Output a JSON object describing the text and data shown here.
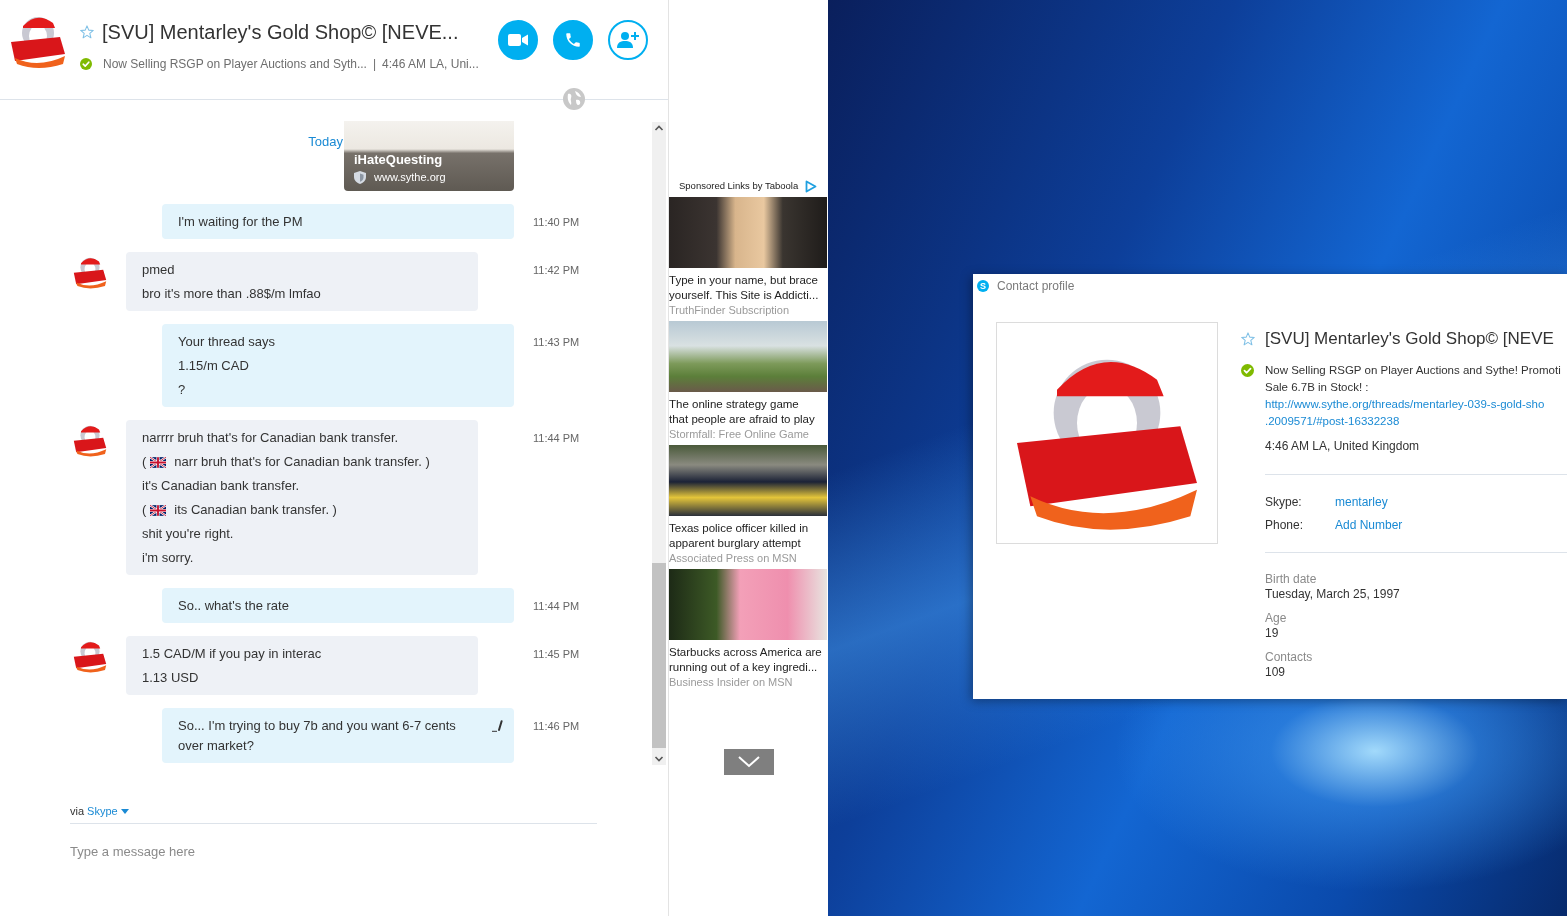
{
  "conversation_header": {
    "title": "[SVU] Mentarley's Gold Shop© [NEVE...",
    "favorite": false,
    "online": true,
    "mood": "Now Selling RSGP on Player Auctions and Syth...",
    "separator": "|",
    "local_time": "4:46 AM LA, Uni..."
  },
  "chat": {
    "date_label": "Today",
    "link_preview": {
      "title": "iHateQuesting",
      "site": "www.sythe.org"
    },
    "messages": [
      {
        "kind": "outgoing",
        "time": "11:40 PM",
        "edited": false,
        "lines": [
          {
            "kind": "text",
            "text": "I'm waiting for the PM"
          }
        ]
      },
      {
        "kind": "incoming",
        "time": "11:42 PM",
        "edited": false,
        "lines": [
          {
            "kind": "text",
            "text": "pmed"
          },
          {
            "kind": "text",
            "text": "bro it's more than .88$/m lmfao"
          }
        ]
      },
      {
        "kind": "outgoing",
        "time": "11:43 PM",
        "edited": false,
        "lines": [
          {
            "kind": "text",
            "text": "Your thread says"
          },
          {
            "kind": "text",
            "text": "1.15/m CAD"
          },
          {
            "kind": "text",
            "text": "?"
          }
        ]
      },
      {
        "kind": "incoming",
        "time": "11:44 PM",
        "edited": false,
        "lines": [
          {
            "kind": "text",
            "text": "narrrr bruh that's for Canadian bank transfer."
          },
          {
            "kind": "translation",
            "open": "(",
            "text": "narr bruh that's for Canadian bank transfer. )"
          },
          {
            "kind": "text",
            "text": "it's Canadian bank transfer."
          },
          {
            "kind": "translation",
            "open": "(",
            "text": "its Canadian bank transfer. )"
          },
          {
            "kind": "text",
            "text": "shit you're right."
          },
          {
            "kind": "text",
            "text": "i'm sorry."
          }
        ]
      },
      {
        "kind": "outgoing",
        "time": "11:44 PM",
        "edited": false,
        "lines": [
          {
            "kind": "text",
            "text": "So.. what's the rate"
          }
        ]
      },
      {
        "kind": "incoming",
        "time": "11:45 PM",
        "edited": false,
        "lines": [
          {
            "kind": "text",
            "text": "1.5 CAD/M if you pay in interac"
          },
          {
            "kind": "text",
            "text": "1.13 USD"
          }
        ]
      },
      {
        "kind": "outgoing",
        "time": "11:46 PM",
        "edited": true,
        "lines": [
          {
            "kind": "text",
            "text": "So... I'm trying to buy 7b and you want 6-7 cents over market?"
          }
        ]
      }
    ],
    "via": {
      "prefix": "via",
      "network": "Skype"
    },
    "composer": {
      "placeholder": "Type a message here"
    }
  },
  "sponsored": {
    "heading": "Sponsored Links by Taboola",
    "ads": [
      {
        "title_lines": [
          "Type in your name, but brace",
          "yourself. This Site is Addicti..."
        ],
        "source": "TruthFinder Subscription"
      },
      {
        "title_lines": [
          "The online strategy game",
          "that people are afraid to play"
        ],
        "source": "Stormfall: Free Online Game"
      },
      {
        "title_lines": [
          "Texas police officer killed in",
          "apparent burglary attempt"
        ],
        "source": "Associated Press on MSN"
      },
      {
        "title_lines": [
          "Starbucks across America are",
          "running out of a key ingredi..."
        ],
        "source": "Business Insider on MSN"
      }
    ]
  },
  "contact_profile": {
    "app_badge": "S",
    "title": "Contact profile",
    "name": "[SVU] Mentarley's Gold Shop© [NEVE",
    "favorite": false,
    "online": true,
    "mood_lines": [
      "Now Selling RSGP on Player Auctions and Sythe! Promoti",
      "Sale 6.7B in Stock! :"
    ],
    "link_lines": [
      "http://www.sythe.org/threads/mentarley-039-s-gold-sho",
      ".2009571/#post-16332238"
    ],
    "local_time": "4:46 AM LA, United Kingdom",
    "fields": [
      {
        "label": "Skype:",
        "value": "mentarley"
      },
      {
        "label": "Phone:",
        "value": "Add Number"
      }
    ],
    "details": [
      {
        "label": "Birth date",
        "value": "Tuesday, March 25, 1997"
      },
      {
        "label": "Age",
        "value": "19"
      },
      {
        "label": "Contacts",
        "value": "109"
      }
    ]
  }
}
